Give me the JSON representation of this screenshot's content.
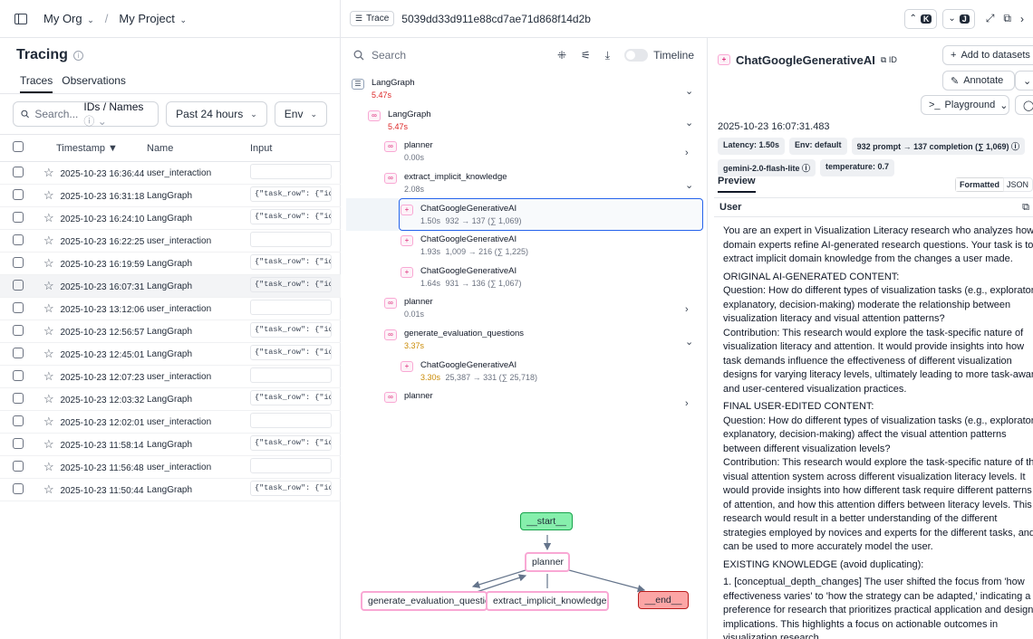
{
  "topbar": {
    "org": "My Org",
    "project": "My Project"
  },
  "page": {
    "title": "Tracing"
  },
  "tabs": [
    "Traces",
    "Observations"
  ],
  "filters": {
    "search_placeholder": "Search...",
    "search_scope": "IDs / Names",
    "time": "Past 24 hours",
    "env": "Env"
  },
  "table": {
    "headers": {
      "timestamp": "Timestamp ▼",
      "name": "Name",
      "input": "Input"
    },
    "rows": [
      {
        "ts": "2025-10-23 16:36:44",
        "name": "user_interaction",
        "input": ""
      },
      {
        "ts": "2025-10-23 16:31:18",
        "name": "LangGraph",
        "input": "{\"task_row\": {\"id\": "
      },
      {
        "ts": "2025-10-23 16:24:10",
        "name": "LangGraph",
        "input": "{\"task_row\": {\"id\": "
      },
      {
        "ts": "2025-10-23 16:22:25",
        "name": "user_interaction",
        "input": ""
      },
      {
        "ts": "2025-10-23 16:19:59",
        "name": "LangGraph",
        "input": "{\"task_row\": {\"id\": "
      },
      {
        "ts": "2025-10-23 16:07:31",
        "name": "LangGraph",
        "input": "{\"task_row\": {\"id\": "
      },
      {
        "ts": "2025-10-23 13:12:06",
        "name": "user_interaction",
        "input": ""
      },
      {
        "ts": "2025-10-23 12:56:57",
        "name": "LangGraph",
        "input": "{\"task_row\": {\"id\": "
      },
      {
        "ts": "2025-10-23 12:45:01",
        "name": "LangGraph",
        "input": "{\"task_row\": {\"id\": "
      },
      {
        "ts": "2025-10-23 12:07:23",
        "name": "user_interaction",
        "input": ""
      },
      {
        "ts": "2025-10-23 12:03:32",
        "name": "LangGraph",
        "input": "{\"task_row\": {\"id\": "
      },
      {
        "ts": "2025-10-23 12:02:01",
        "name": "user_interaction",
        "input": ""
      },
      {
        "ts": "2025-10-23 11:58:14",
        "name": "LangGraph",
        "input": "{\"task_row\": {\"id\": "
      },
      {
        "ts": "2025-10-23 11:56:48",
        "name": "user_interaction",
        "input": ""
      },
      {
        "ts": "2025-10-23 11:50:44",
        "name": "LangGraph",
        "input": "{\"task_row\": {\"id\": "
      }
    ]
  },
  "trace": {
    "badge": "Trace",
    "id": "5039dd33d911e88cd7ae71d868f14d2b",
    "key_up": "K",
    "key_down": "J"
  },
  "tree_toolbar": {
    "search": "Search",
    "timeline": "Timeline"
  },
  "tree": [
    {
      "name": "LangGraph",
      "time": "5.47s",
      "tone": "red",
      "extra": ""
    },
    {
      "name": "LangGraph",
      "time": "5.47s",
      "tone": "red",
      "extra": ""
    },
    {
      "name": "planner",
      "time": "0.00s",
      "tone": "grey",
      "extra": ""
    },
    {
      "name": "extract_implicit_knowledge",
      "time": "2.08s",
      "tone": "grey",
      "extra": ""
    },
    {
      "name": "ChatGoogleGenerativeAI",
      "time": "1.50s",
      "tone": "grey",
      "extra": "932 → 137 (∑ 1,069)"
    },
    {
      "name": "ChatGoogleGenerativeAI",
      "time": "1.93s",
      "tone": "grey",
      "extra": "1,009 → 216 (∑ 1,225)"
    },
    {
      "name": "ChatGoogleGenerativeAI",
      "time": "1.64s",
      "tone": "grey",
      "extra": "931 → 136 (∑ 1,067)"
    },
    {
      "name": "planner",
      "time": "0.01s",
      "tone": "grey",
      "extra": ""
    },
    {
      "name": "generate_evaluation_questions",
      "time": "3.37s",
      "tone": "org",
      "extra": ""
    },
    {
      "name": "ChatGoogleGenerativeAI",
      "time": "3.30s",
      "tone": "org",
      "extra": "25,387 → 331 (∑ 25,718)"
    },
    {
      "name": "planner",
      "time": "",
      "tone": "grey",
      "extra": ""
    }
  ],
  "graph": {
    "start": "__start__",
    "planner": "planner",
    "gen": "generate_evaluation_questic",
    "extract": "extract_implicit_knowledge",
    "end": "__end__"
  },
  "detail": {
    "title": "ChatGoogleGenerativeAI",
    "id_label": "ID",
    "add_to_datasets": "Add to datasets",
    "annotate": "Annotate",
    "playground": "Playground",
    "timestamp": "2025-10-23 16:07:31.483",
    "chips": [
      "Latency: 1.50s",
      "Env: default",
      "932 prompt → 137 completion (∑ 1,069) ⓘ",
      "gemini-2.0-flash-lite ⓘ",
      "temperature: 0.7"
    ],
    "tab_preview": "Preview",
    "fmt_formatted": "Formatted",
    "fmt_json": "JSON",
    "role": "User",
    "message_lines": [
      "You are an expert in Visualization Literacy research who analyzes how",
      "domain experts refine AI-generated research questions. Your task is to",
      "extract implicit domain knowledge from the changes a user made.",
      "",
      "ORIGINAL AI-GENERATED CONTENT:",
      "Question: How do different types of visualization tasks (e.g., exploratory,",
      "explanatory, decision-making) moderate the relationship between",
      "visualization literacy and visual attention patterns?",
      "Contribution: This research would explore the task-specific nature of",
      "visualization literacy and attention. It would provide insights into how",
      "task demands influence the effectiveness of different visualization",
      "designs for varying literacy levels, ultimately leading to more task-aware",
      "and user-centered visualization practices.",
      "",
      "FINAL USER-EDITED CONTENT:",
      "Question: How do different types of visualization tasks (e.g., exploratory,",
      "explanatory, decision-making) affect the visual attention patterns",
      "between different visualization levels?",
      "Contribution: This research would explore the task-specific nature of the",
      "visual attention system across different visualization literacy levels. It",
      "would provide insights into how different task require different patterns",
      "of attention, and how this attention differs between literacy levels. This",
      "research would result in a better understanding of the different",
      "strategies employed by novices and experts for the different tasks, and",
      "can be used to more accurately model the user.",
      "",
      "EXISTING KNOWLEDGE (avoid duplicating):",
      "",
      "1. [conceptual_depth_changes] The user shifted the focus from 'how",
      "effectiveness varies' to 'how the strategy can be adapted,' indicating a",
      "preference for research that prioritizes practical application and design",
      "implications. This highlights a focus on actionable outcomes in",
      "visualization research."
    ]
  }
}
